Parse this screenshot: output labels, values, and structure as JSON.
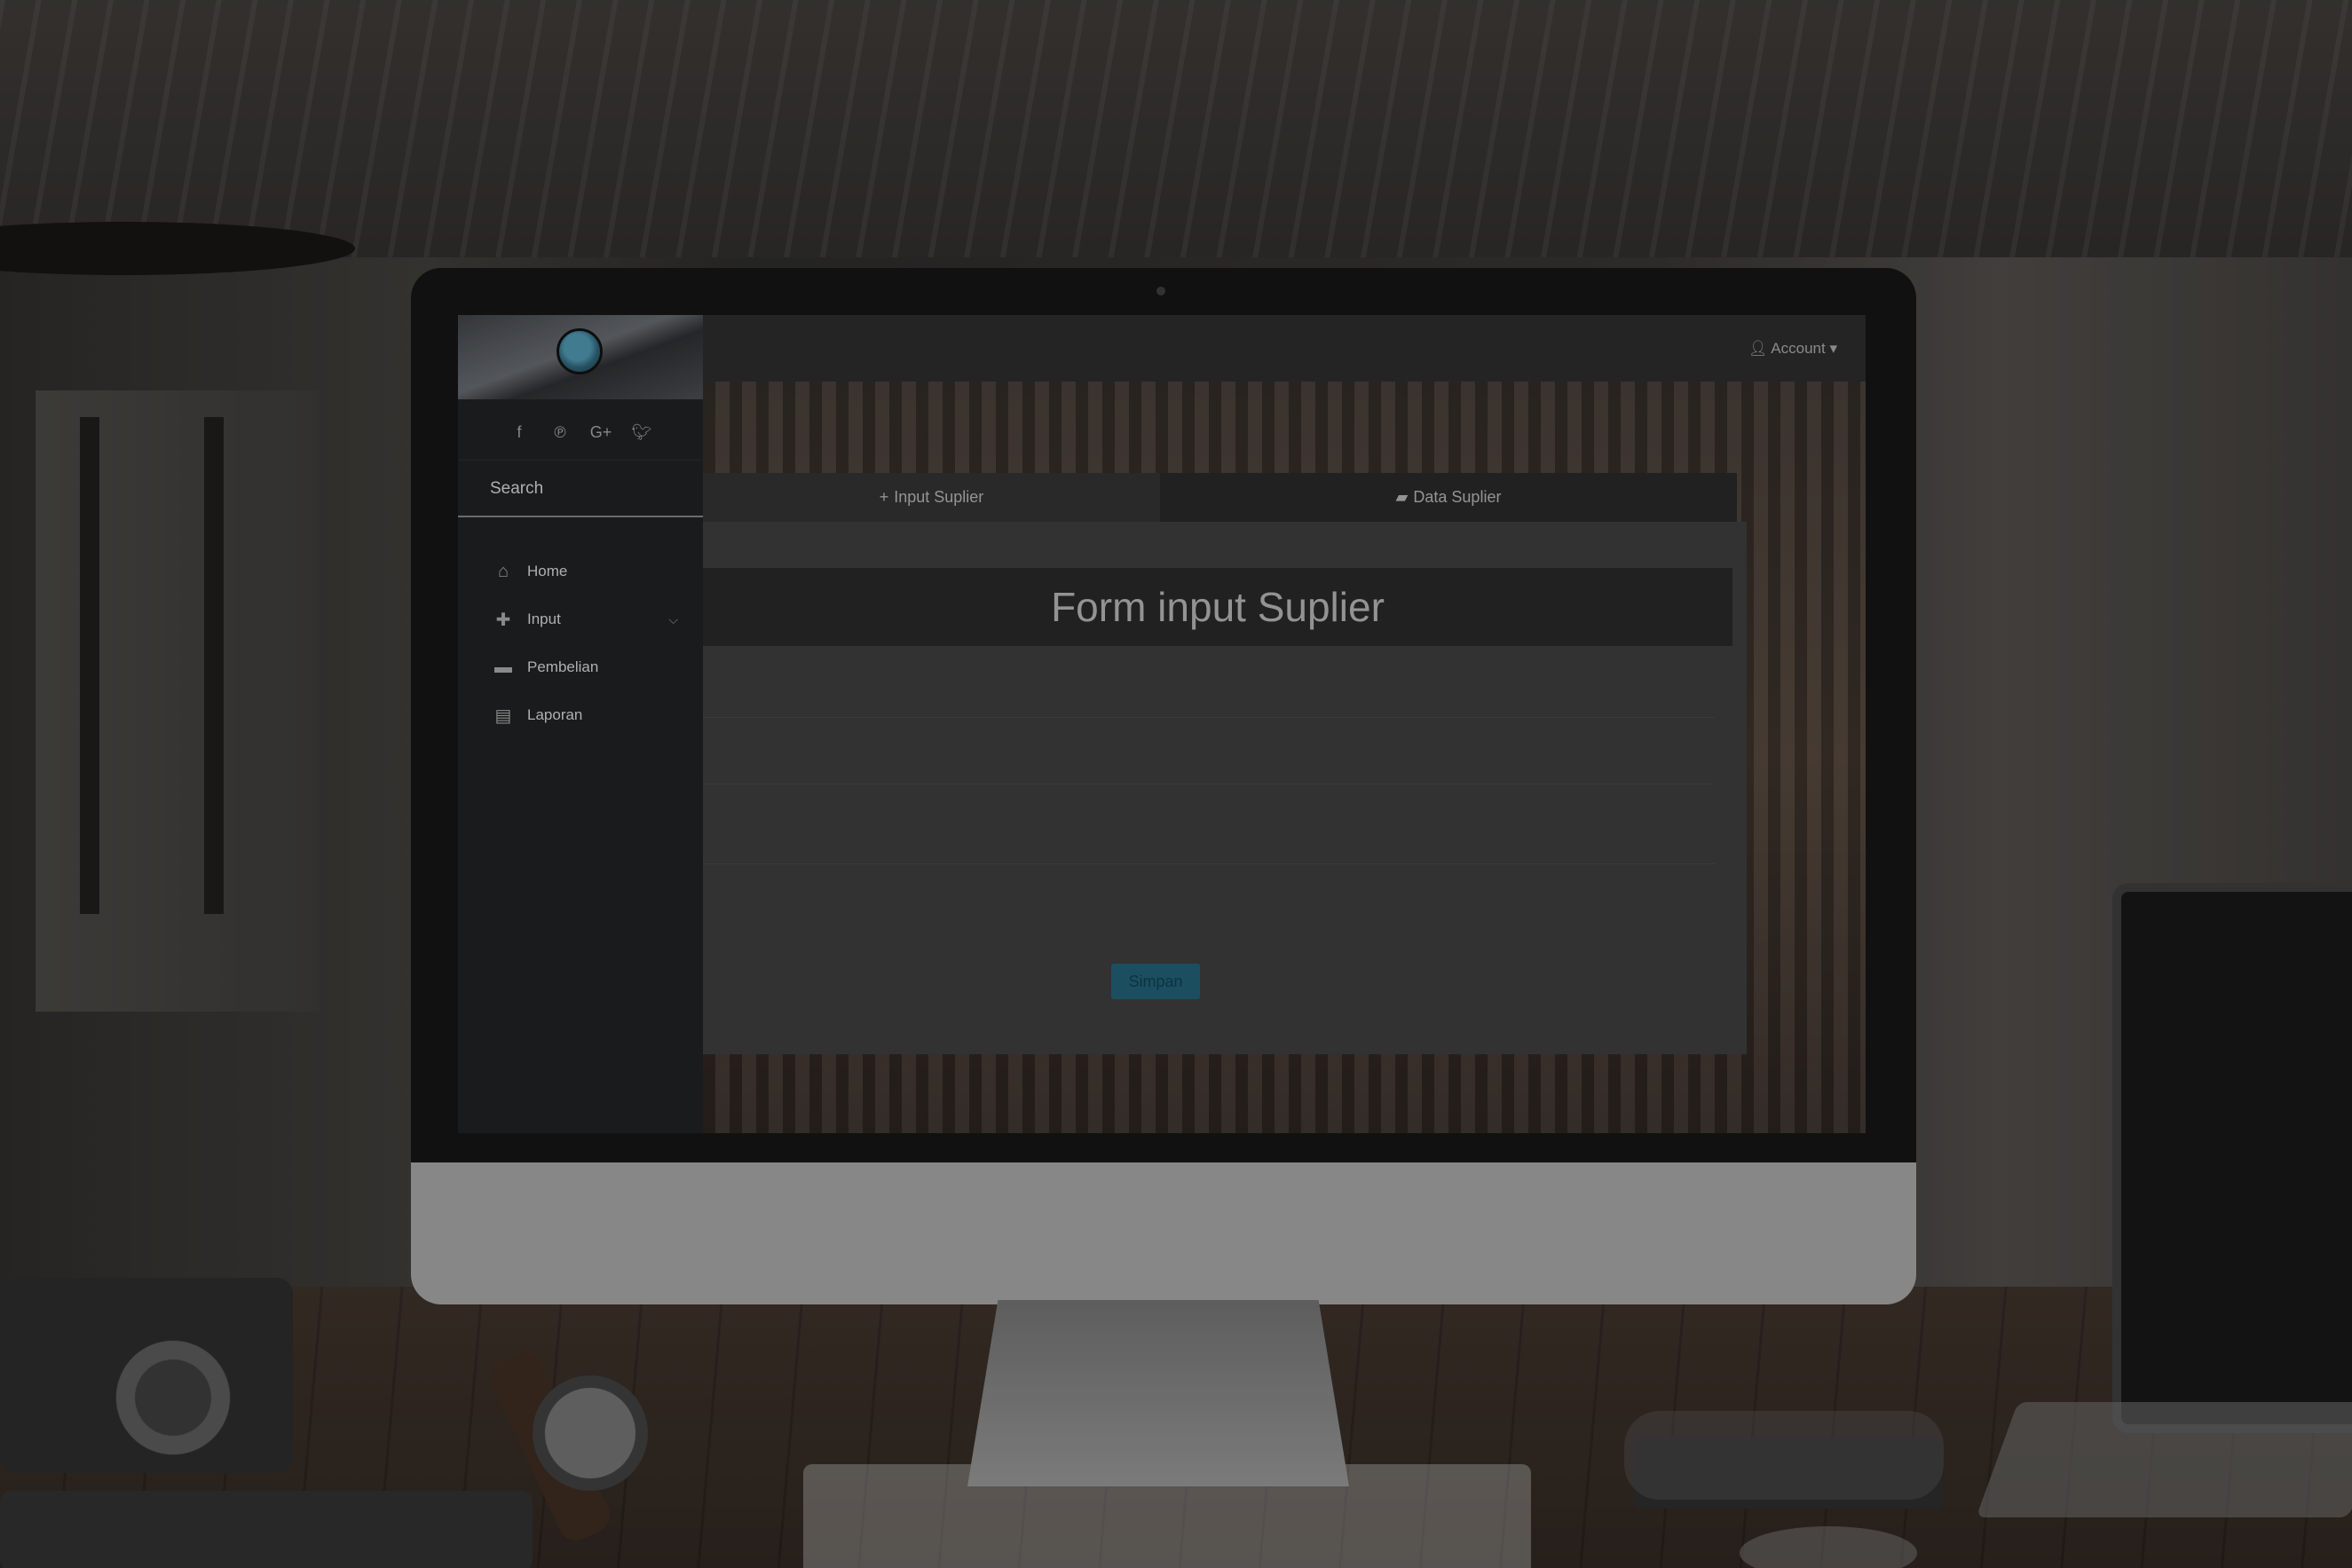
{
  "sidebar": {
    "social_icons": [
      "facebook-icon",
      "pinterest-icon",
      "google-plus-icon",
      "twitter-icon"
    ],
    "search_placeholder": "Search",
    "items": [
      {
        "label": "Home",
        "icon": "home-icon"
      },
      {
        "label": "Input",
        "icon": "plus-icon",
        "expandable": true
      },
      {
        "label": "Pembelian",
        "icon": "credit-card-icon"
      },
      {
        "label": "Laporan",
        "icon": "clipboard-icon"
      }
    ]
  },
  "topbar": {
    "account_label": "Account"
  },
  "tabs": [
    {
      "label": "Input Suplier",
      "icon": "plus-icon"
    },
    {
      "label": "Data Suplier",
      "icon": "folder-icon"
    }
  ],
  "form": {
    "title": "Form input Suplier",
    "submit_label": "Simpan"
  },
  "colors": {
    "sidebar_bg": "#1e1f20",
    "panel_title_bg": "#262626",
    "button_bg": "#1f5b6e"
  }
}
